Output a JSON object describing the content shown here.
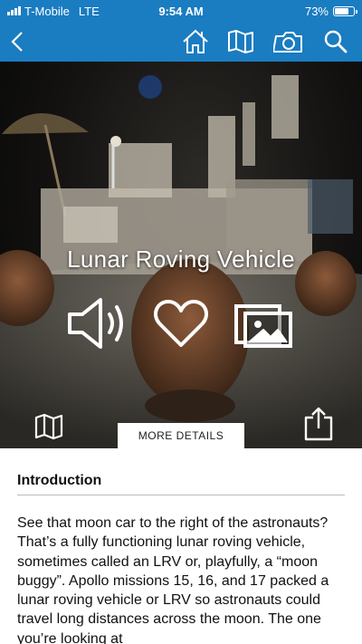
{
  "status_bar": {
    "carrier": "T-Mobile",
    "network": "LTE",
    "time": "9:54 AM",
    "battery_percent": "73%",
    "battery_level": 0.73
  },
  "nav": {
    "icons": [
      "back-icon",
      "home-icon",
      "map-icon",
      "camera-icon",
      "search-icon"
    ]
  },
  "hero": {
    "title": "Lunar Roving Vehicle",
    "more_details_label": "MORE DETAILS",
    "actions": [
      "speaker-icon",
      "heart-icon",
      "gallery-icon"
    ],
    "bottom_icons": [
      "map-icon",
      "share-icon"
    ]
  },
  "content": {
    "section_title": "Introduction",
    "body": "See that moon car to the right of the astronauts? That’s a fully functioning lunar roving vehicle, sometimes called an LRV or, playfully, a “moon buggy”. Apollo missions 15, 16, and 17 packed a lunar roving vehicle or LRV so astronauts could travel long distances across the moon. The one you’re looking at"
  },
  "colors": {
    "brand": "#1a7cc1",
    "text": "#111111"
  }
}
